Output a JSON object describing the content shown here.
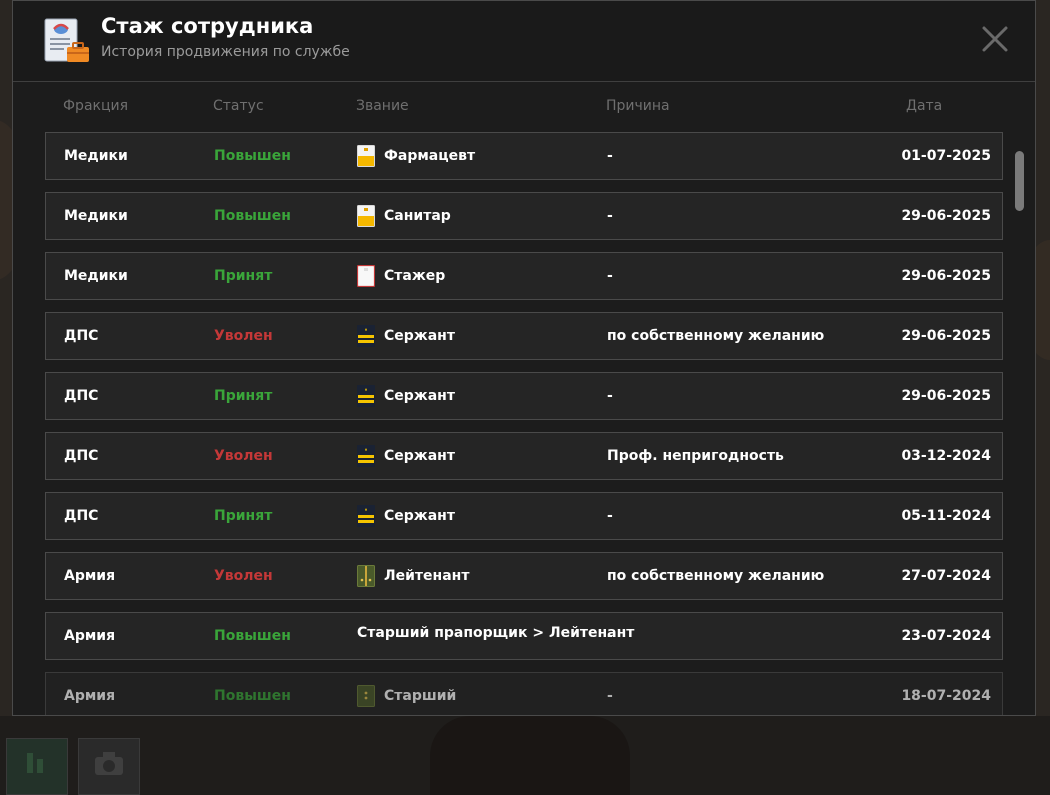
{
  "header": {
    "title": "Стаж сотрудника",
    "subtitle": "История продвижения по службе"
  },
  "columns": {
    "faction": "Фракция",
    "status": "Статус",
    "rank": "Звание",
    "reason": "Причина",
    "date": "Дата"
  },
  "colors": {
    "status_up": "#3aa53a",
    "status_fired": "#c43838",
    "background": "#1c1c1c",
    "row_bg": "#252525"
  },
  "rows": [
    {
      "faction": "Медики",
      "status": "Повышен",
      "status_type": "up",
      "rank": "Фармацевт",
      "rank_icon": "medic-rank-gold-icon",
      "reason": "-",
      "date": "01-07-2025"
    },
    {
      "faction": "Медики",
      "status": "Повышен",
      "status_type": "up",
      "rank": "Санитар",
      "rank_icon": "medic-rank-gold-icon",
      "reason": "-",
      "date": "29-06-2025"
    },
    {
      "faction": "Медики",
      "status": "Принят",
      "status_type": "hired",
      "rank": "Стажер",
      "rank_icon": "medic-rank-white-icon",
      "reason": "-",
      "date": "29-06-2025"
    },
    {
      "faction": "ДПС",
      "status": "Уволен",
      "status_type": "fired",
      "rank": "Сержант",
      "rank_icon": "police-sergeant-icon",
      "reason": "по собственному желанию",
      "date": "29-06-2025"
    },
    {
      "faction": "ДПС",
      "status": "Принят",
      "status_type": "hired",
      "rank": "Сержант",
      "rank_icon": "police-sergeant-icon",
      "reason": "-",
      "date": "29-06-2025"
    },
    {
      "faction": "ДПС",
      "status": "Уволен",
      "status_type": "fired",
      "rank": "Сержант",
      "rank_icon": "police-sergeant-icon",
      "reason": "Проф. непригодность",
      "date": "03-12-2024"
    },
    {
      "faction": "ДПС",
      "status": "Принят",
      "status_type": "hired",
      "rank": "Сержант",
      "rank_icon": "police-sergeant-icon",
      "reason": "-",
      "date": "05-11-2024"
    },
    {
      "faction": "Армия",
      "status": "Уволен",
      "status_type": "fired",
      "rank": "Лейтенант",
      "rank_icon": "army-lieutenant-icon",
      "reason": "по собственному желанию",
      "date": "27-07-2024"
    },
    {
      "faction": "Армия",
      "status": "Повышен",
      "status_type": "up",
      "rank": "Старший прапорщик > Лейтенант",
      "rank_icon": "",
      "reason": "-",
      "date": "23-07-2024"
    },
    {
      "faction": "Армия",
      "status": "Повышен",
      "status_type": "up",
      "rank": "Старший",
      "rank_icon": "army-rank-icon",
      "reason": "-",
      "date": "18-07-2024"
    }
  ]
}
